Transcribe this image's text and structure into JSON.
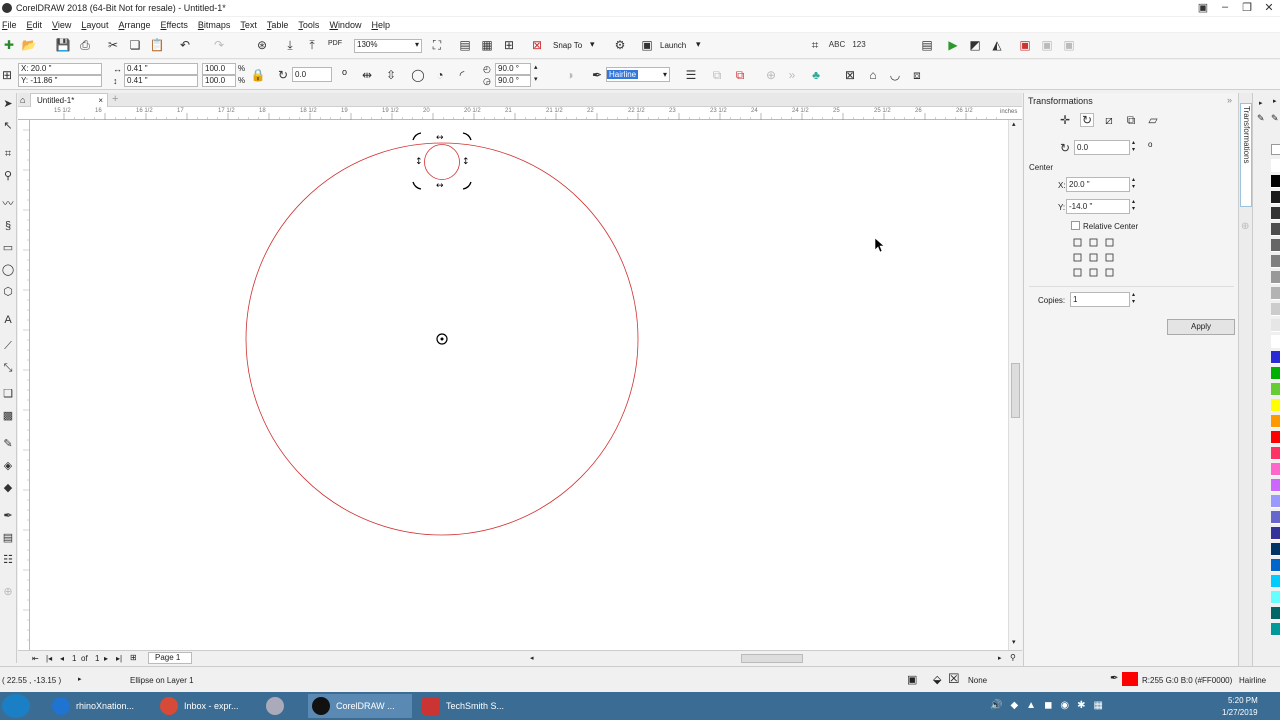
{
  "window": {
    "title": "CorelDRAW 2018 (64-Bit Not for resale) - Untitled-1*"
  },
  "menu": [
    "File",
    "Edit",
    "View",
    "Layout",
    "Arrange",
    "Effects",
    "Bitmaps",
    "Text",
    "Table",
    "Tools",
    "Window",
    "Help"
  ],
  "standard_toolbar": {
    "zoom_value": "130%",
    "snap_to_label": "Snap To",
    "launch_label": "Launch",
    "pdf_label": "PDF"
  },
  "property_bar": {
    "x": "X: 20.0 \"",
    "y": "Y: -11.86 \"",
    "width": "0.41 \"",
    "height": "0.41 \"",
    "scale_w": "100.0",
    "scale_h": "100.0",
    "pct": "%",
    "rotation": "0.0",
    "start_angle": "90.0 °",
    "end_angle": "90.0 °",
    "outline": "Hairline"
  },
  "document": {
    "tab_label": "Untitled-1*",
    "page_nav": {
      "current": "1",
      "of": "of",
      "total": "1",
      "page_label": "Page 1"
    }
  },
  "ruler": {
    "units": "inches",
    "labels": [
      "15 1/2",
      "16",
      "16 1/2",
      "17",
      "17 1/2",
      "18",
      "18 1/2",
      "19",
      "19 1/2",
      "20",
      "20 1/2",
      "21",
      "21 1/2",
      "22",
      "22 1/2",
      "23",
      "23 1/2",
      "24",
      "24 1/2",
      "25",
      "25 1/2",
      "26",
      "26 1/2"
    ]
  },
  "docker": {
    "title": "Transformations",
    "tab_label": "Transformations",
    "rotation_value": "0.0",
    "center_label": "Center",
    "x_label": "X:",
    "x_value": "20.0 \"",
    "y_label": "Y:",
    "y_value": "-14.0 \"",
    "relative_center_label": "Relative Center",
    "copies_label": "Copies:",
    "copies_value": "1",
    "apply_label": "Apply"
  },
  "status": {
    "coords": "( 22.55 , -13.15 )",
    "selection": "Ellipse on Layer 1",
    "fill_label": "None",
    "color_readout": "R:255 G:0 B:0 (#FF0000)",
    "outline_label": "Hairline",
    "outline_color": "#FF0000"
  },
  "taskbar": {
    "apps": [
      "rhinoXnation...",
      "Inbox - expr...",
      "CorelDRAW ...",
      "TechSmith S..."
    ],
    "time": "5:20 PM",
    "date": "1/27/2019"
  },
  "palette_colors": [
    "#ffffff",
    "#000000",
    "#1a1a1a",
    "#333333",
    "#4d4d4d",
    "#666666",
    "#808080",
    "#999999",
    "#b3b3b3",
    "#cccccc",
    "#e6e6e6",
    "#ffffff",
    "#2b2bd6",
    "#00b000",
    "#66cc33",
    "#ffff00",
    "#ff9900",
    "#ff0000",
    "#ff3366",
    "#ff66cc",
    "#cc66ff",
    "#9999ff",
    "#6666cc",
    "#333399",
    "#003366",
    "#0066cc",
    "#00ccff",
    "#66ffff",
    "#006666",
    "#009999"
  ]
}
